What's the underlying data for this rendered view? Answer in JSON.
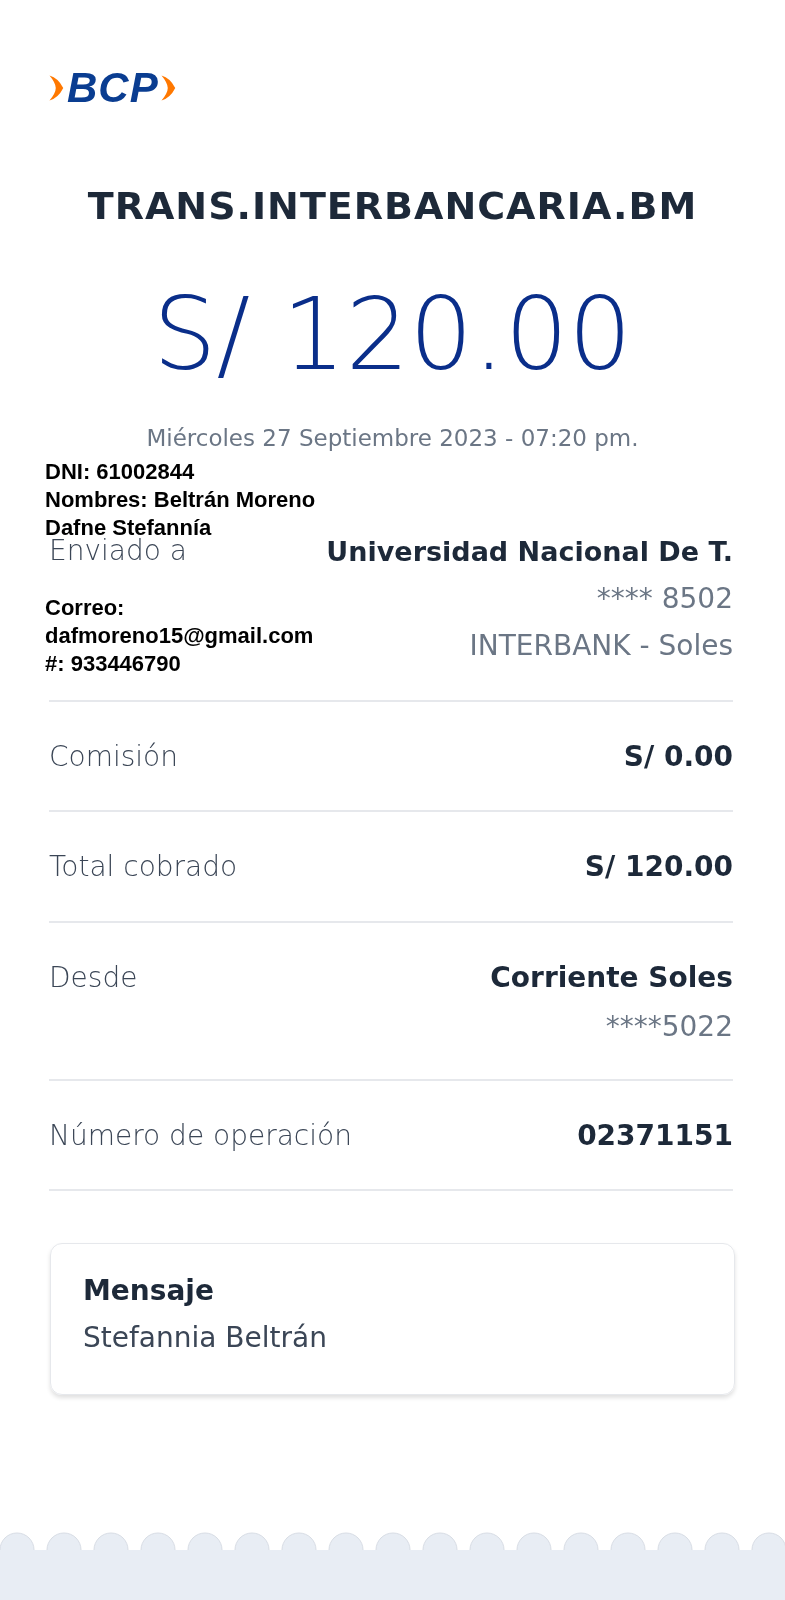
{
  "logo": {
    "text": "BCP"
  },
  "title": "TRANS.INTERBANCARIA.BM",
  "amount": "S/ 120.00",
  "date": "Miércoles 27 Septiembre 2023 - 07:20 pm.",
  "recipient": {
    "label": "Enviado a",
    "name": "Universidad Nacional De T.",
    "account": "**** 8502",
    "bank": "INTERBANK - Soles"
  },
  "details": [
    {
      "label": "Comisión",
      "value": "S/ 0.00"
    },
    {
      "label": "Total cobrado",
      "value": "S/ 120.00"
    },
    {
      "label": "Desde",
      "value": "Corriente Soles",
      "sub": "****5022"
    },
    {
      "label": "Número de operación",
      "value": "02371151"
    }
  ],
  "message": {
    "title": "Mensaje",
    "text": "Stefannia Beltrán"
  },
  "overlay_note": {
    "top_lines": [
      "DNI: 61002844",
      "Nombres: Beltrán Moreno",
      "Dafne Stefannía"
    ],
    "bottom_lines": [
      "Correo:",
      "dafmoreno15@gmail.com",
      "#: 933446790"
    ]
  }
}
